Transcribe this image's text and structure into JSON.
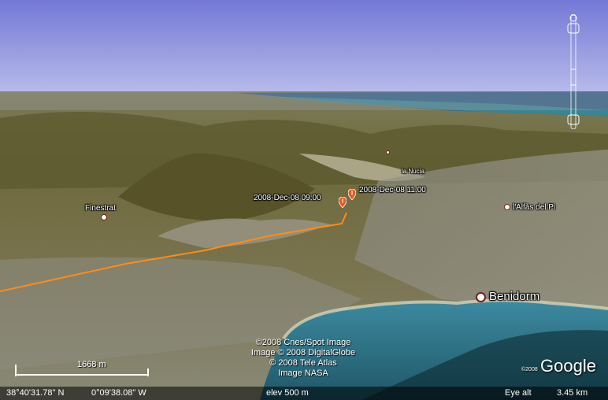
{
  "places": {
    "finestrat": "Finestrat",
    "la_nucia": "la Nucia",
    "alfas_del_pi": "l'Alfàs del Pi",
    "benidorm": "Benidorm"
  },
  "markers": {
    "start_label": "2008-Dec-08 09:00",
    "end_label": "2008-Dec-08 11:00"
  },
  "copyright": {
    "line1": "©2008 Cnes/Spot Image",
    "line2": "Image © 2008 DigitalGlobe",
    "line3": "© 2008 Tele Atlas",
    "line4": "Image NASA"
  },
  "scale_bar": {
    "label": "1668 m"
  },
  "status": {
    "lat": "38°40'31.78\" N",
    "lon": "0°09'38.08\" W",
    "elev": "elev  500 m",
    "eye_alt_label": "Eye alt",
    "eye_alt_value": "3.45 km"
  },
  "branding": {
    "logo": "Google",
    "year": "©2008"
  },
  "colors": {
    "sky_top": "#7a7fd8",
    "sky_bottom": "#b4b9e8",
    "sea": "#2d6e82",
    "track": "#ff8c1a",
    "marker": "#e65a1e",
    "terrain": "#6f6a3e"
  }
}
